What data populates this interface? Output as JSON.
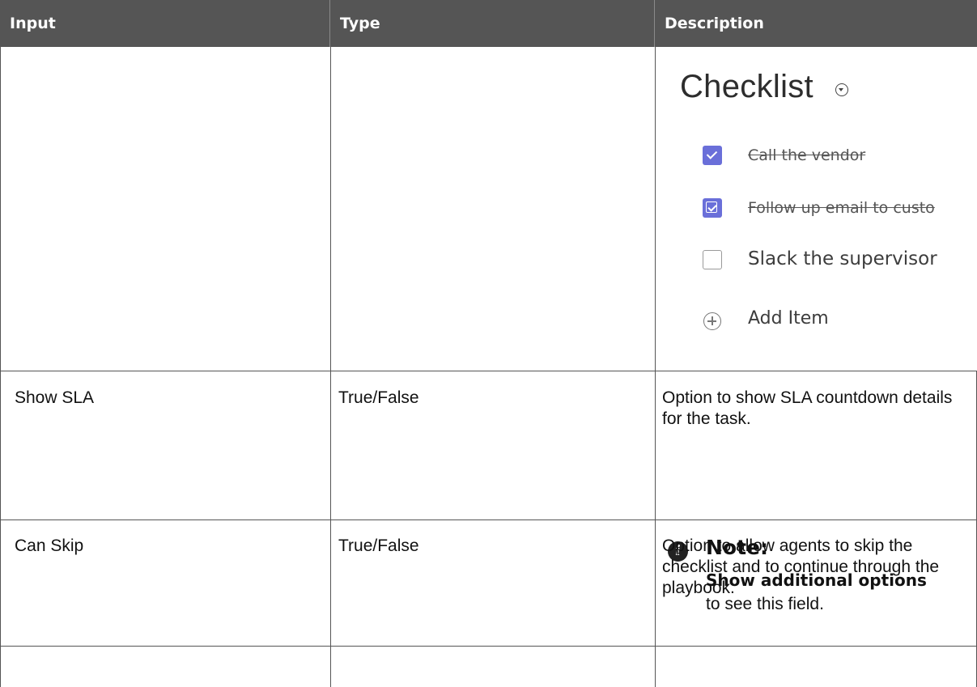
{
  "table": {
    "headers": [
      "Input",
      "Type",
      "Description"
    ],
    "rows": [
      {
        "input": "",
        "type": "",
        "description_image": {
          "title": "Checklist",
          "items": [
            {
              "label": "Call the vendor",
              "checked": true
            },
            {
              "label": "Follow up email to custo",
              "checked": true
            },
            {
              "label": "Slack the supervisor",
              "checked": false
            }
          ],
          "add_item_label": "Add Item",
          "checkbox_color": "#6a6fd9"
        }
      },
      {
        "input": "Show SLA",
        "type": "True/False",
        "description": "Option to show SLA countdown details for the task.",
        "note": {
          "title": "Note:",
          "bold_text": "Show additional options",
          "text": "to see this field."
        }
      },
      {
        "input": "Can Skip",
        "type": "True/False",
        "description": "Option to allow agents to skip the checklist and to continue through the playbook."
      }
    ]
  },
  "colors": {
    "header_bg": "#555555",
    "header_text": "#ffffff",
    "grid": "#555555"
  }
}
